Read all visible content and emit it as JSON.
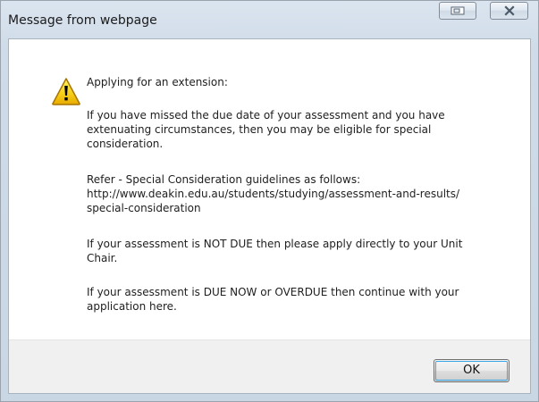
{
  "window": {
    "title": "Message from webpage",
    "icons": {
      "restore": "restore-icon",
      "close": "close-icon",
      "warning": "warning-icon"
    }
  },
  "message": {
    "lines": [
      "Applying for an extension:",
      "If you have missed the due date of your assessment and you have\nextenuating circumstances, then you may be eligible for special\nconsideration.",
      "Refer - Special Consideration guidelines as follows:\nhttp://www.deakin.edu.au/students/studying/assessment-and-results/\nspecial-consideration",
      "If your assessment is NOT DUE then please apply directly to your Unit\nChair.",
      "If your assessment is DUE NOW or OVERDUE then continue with  your\napplication here."
    ]
  },
  "buttons": {
    "ok": "OK"
  },
  "colors": {
    "frame": "#cfdbe8",
    "button_bar": "#f0f0f0",
    "focus": "#38a7e6",
    "warning": "#f2c400"
  }
}
